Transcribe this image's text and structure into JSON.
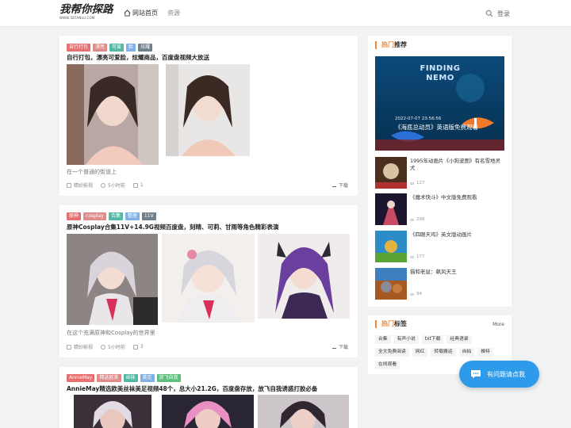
{
  "header": {
    "logo_main": "我帮你探路",
    "logo_sub": "WWW.5BTANLU.COM",
    "nav": [
      {
        "label": "网站首页"
      },
      {
        "label": "资源"
      }
    ],
    "login": "登录"
  },
  "posts": [
    {
      "tags": [
        {
          "label": "自行打包",
          "color": "#e86f6f"
        },
        {
          "label": "漂亮",
          "color": "#e08a8a"
        },
        {
          "label": "可爱",
          "color": "#54b8a4"
        },
        {
          "label": "脸",
          "color": "#7fb0e6"
        },
        {
          "label": "炫耀",
          "color": "#6f7f8c"
        }
      ],
      "title": "自行打包，漂亮可爱脸，炫耀商品，百度盘视频大放送",
      "desc": "在一个普通的街道上",
      "author": "精妙影视",
      "time": "5小时前",
      "likes": "1",
      "download": "下载"
    },
    {
      "tags": [
        {
          "label": "原神",
          "color": "#e86f6f"
        },
        {
          "label": "cosplay",
          "color": "#e08a8a"
        },
        {
          "label": "合集",
          "color": "#54b8a4"
        },
        {
          "label": "整理",
          "color": "#7fb0e6"
        },
        {
          "label": "11V",
          "color": "#6f7f8c"
        }
      ],
      "title": "原神Cosplay合集11V+14.9G视频百度盘，刻晴、可莉、甘雨等角色精彩表演",
      "desc": "在这个充满原神和Cosplay的世界里",
      "author": "精妙影视",
      "time": "5小时前",
      "likes": "3",
      "download": "下载"
    },
    {
      "tags": [
        {
          "label": "AnnieMay",
          "color": "#e86f6f"
        },
        {
          "label": "精选欧美",
          "color": "#e08a8a"
        },
        {
          "label": "丝袜",
          "color": "#54b8a4"
        },
        {
          "label": "美足",
          "color": "#7fb0e6"
        },
        {
          "label": "放飞自我",
          "color": "#5fbf7a"
        }
      ],
      "title": "AnnieMay精选欧美丝袜美足视频48个，总大小21.2G，百度盘存放，放飞自我诱惑打胶必备"
    }
  ],
  "sidebar": {
    "hot": {
      "title_hl": "热门",
      "title_rest": "推荐",
      "featured": {
        "poster_title": "FINDING NEMO",
        "date": "2022-07-07 23:56:56",
        "caption": "《海底总动员》英语版免费观看"
      },
      "items": [
        {
          "title": "1995年动画片《小狗波图》有名雪地灵犬",
          "views": "127"
        },
        {
          "title": "《魔术快斗》中文版免费观看",
          "views": "298"
        },
        {
          "title": "《四眼天鸡》英文版动画片",
          "views": "177"
        },
        {
          "title": "猫和老鼠：飙风天王",
          "views": "94"
        }
      ]
    },
    "tags": {
      "title_hl": "热门",
      "title_rest": "标签",
      "more": "More",
      "items": [
        "合集",
        "有声小说",
        "txt下载",
        "经典语录",
        "全文免费阅读",
        "网红",
        "转载搬运",
        "自拍",
        "推特",
        "在线观看"
      ]
    }
  },
  "ask_button": "有问题请点我"
}
